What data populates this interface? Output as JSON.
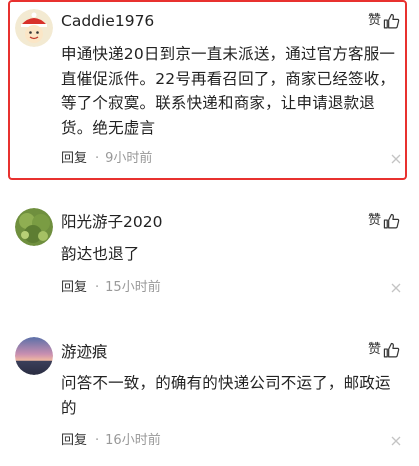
{
  "labels": {
    "like": "赞",
    "reply": "回复",
    "separator": "·"
  },
  "comments": [
    {
      "username": "Caddie1976",
      "text": "申通快递20日到京一直未派送，通过官方客服一直催促派件。22号再看召回了，商家已经签收，等了个寂寞。联系快递和商家，让申请退款退货。绝无虚言",
      "time": "9小时前",
      "highlighted": true,
      "avatar_icon": "cartoon-avatar-icon"
    },
    {
      "username": "阳光游子2020",
      "text": "韵达也退了",
      "time": "15小时前",
      "highlighted": false,
      "avatar_icon": "tree-avatar-icon"
    },
    {
      "username": "游迹痕",
      "text": "问答不一致，的确有的快递公司不运了，邮政运的",
      "time": "16小时前",
      "highlighted": false,
      "avatar_icon": "sunset-avatar-icon"
    }
  ],
  "colors": {
    "highlight_border": "#e8312f",
    "text": "#222222",
    "muted": "#999999"
  }
}
